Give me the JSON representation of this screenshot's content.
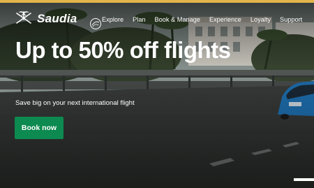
{
  "brand": {
    "name": "Saudia",
    "accent_color": "#e3b449",
    "cta_color": "#0d8a4f"
  },
  "nav": {
    "items": [
      {
        "label": "Explore"
      },
      {
        "label": "Plan"
      },
      {
        "label": "Book & Manage"
      },
      {
        "label": "Experience"
      },
      {
        "label": "Loyalty"
      },
      {
        "label": "Support"
      }
    ]
  },
  "hero": {
    "headline": "Up to 50% off flights",
    "subtext": "Save big on your next international flight",
    "cta_label": "Book now"
  },
  "icons": {
    "logo": "saudia-palm-swords-icon",
    "badge": "vision-2030-icon"
  }
}
